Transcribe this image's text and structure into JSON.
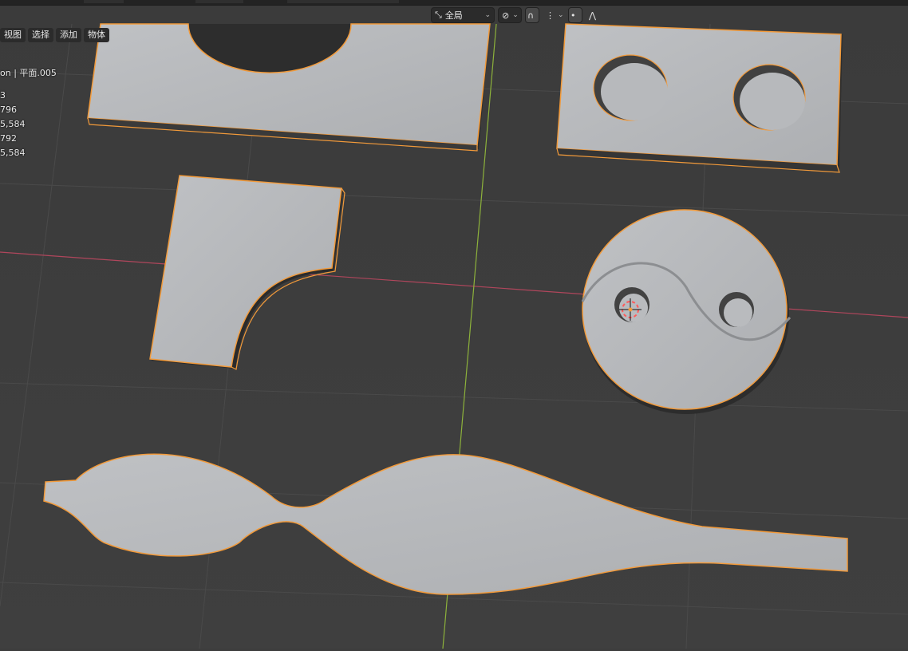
{
  "header": {
    "orientation_icon": "transform-orientation-icon",
    "orientation_label": "全局",
    "pivot_icon": "pivot-point-icon",
    "snap_icon": "magnet-icon",
    "snap_target_icon": "snap-increment-icon",
    "proportional_icon": "proportional-edit-icon",
    "falloff_icon": "falloff-curve-icon"
  },
  "menu": {
    "view": "视图",
    "select": "选择",
    "add": "添加",
    "object": "物体"
  },
  "overlay": {
    "object_line": "on | 平面.005",
    "stats": [
      "3",
      "796",
      "5,584",
      "792",
      "5,584"
    ]
  },
  "colors": {
    "background": "#3d3d3d",
    "mesh_fill": "#b9bbbe",
    "selection_outline": "#f29a3a",
    "x_axis": "#b0465c",
    "y_axis": "#8db23b"
  }
}
